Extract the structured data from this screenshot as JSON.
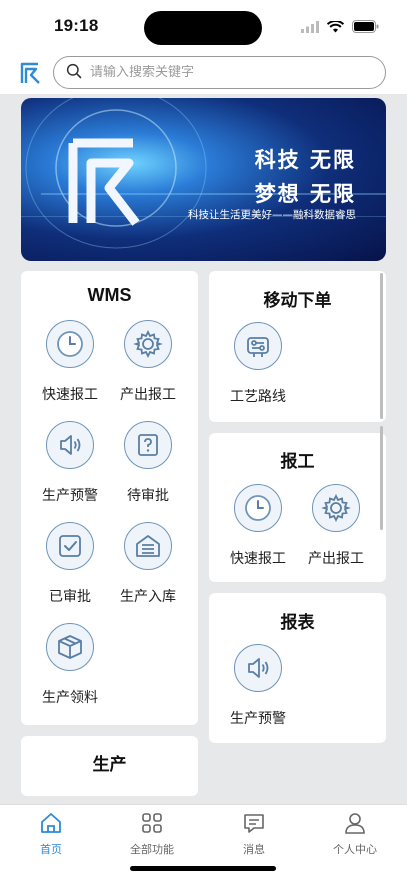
{
  "status": {
    "time": "19:18"
  },
  "search": {
    "placeholder": "请输入搜索关键字"
  },
  "banner": {
    "headline1": "科技 无限",
    "headline2": "梦想 无限",
    "slogan": "科技让生活更美好——融科数据睿思"
  },
  "wms": {
    "title": "WMS",
    "items": [
      {
        "label": "快速报工",
        "icon": "clock-icon"
      },
      {
        "label": "产出报工",
        "icon": "gear-icon"
      },
      {
        "label": "生产预警",
        "icon": "speaker-icon"
      },
      {
        "label": "待审批",
        "icon": "question-icon"
      },
      {
        "label": "已审批",
        "icon": "check-icon"
      },
      {
        "label": "生产入库",
        "icon": "warehouse-icon"
      },
      {
        "label": "生产领料",
        "icon": "box-icon"
      }
    ]
  },
  "production": {
    "title": "生产"
  },
  "mobile_order": {
    "title": "移动下单",
    "items": [
      {
        "label": "工艺路线",
        "icon": "route-icon"
      }
    ]
  },
  "report_work": {
    "title": "报工",
    "items": [
      {
        "label": "快速报工",
        "icon": "clock-icon"
      },
      {
        "label": "产出报工",
        "icon": "gear-icon"
      }
    ]
  },
  "reports": {
    "title": "报表",
    "items": [
      {
        "label": "生产预警",
        "icon": "speaker-icon"
      }
    ]
  },
  "tabs": [
    {
      "label": "首页",
      "icon": "home-icon",
      "active": true
    },
    {
      "label": "全部功能",
      "icon": "grid-icon",
      "active": false
    },
    {
      "label": "消息",
      "icon": "message-icon",
      "active": false
    },
    {
      "label": "个人中心",
      "icon": "user-icon",
      "active": false
    }
  ],
  "colors": {
    "accent": "#2e8bd4",
    "icon_stroke": "#6f95b8",
    "background": "#e7e8ea"
  }
}
